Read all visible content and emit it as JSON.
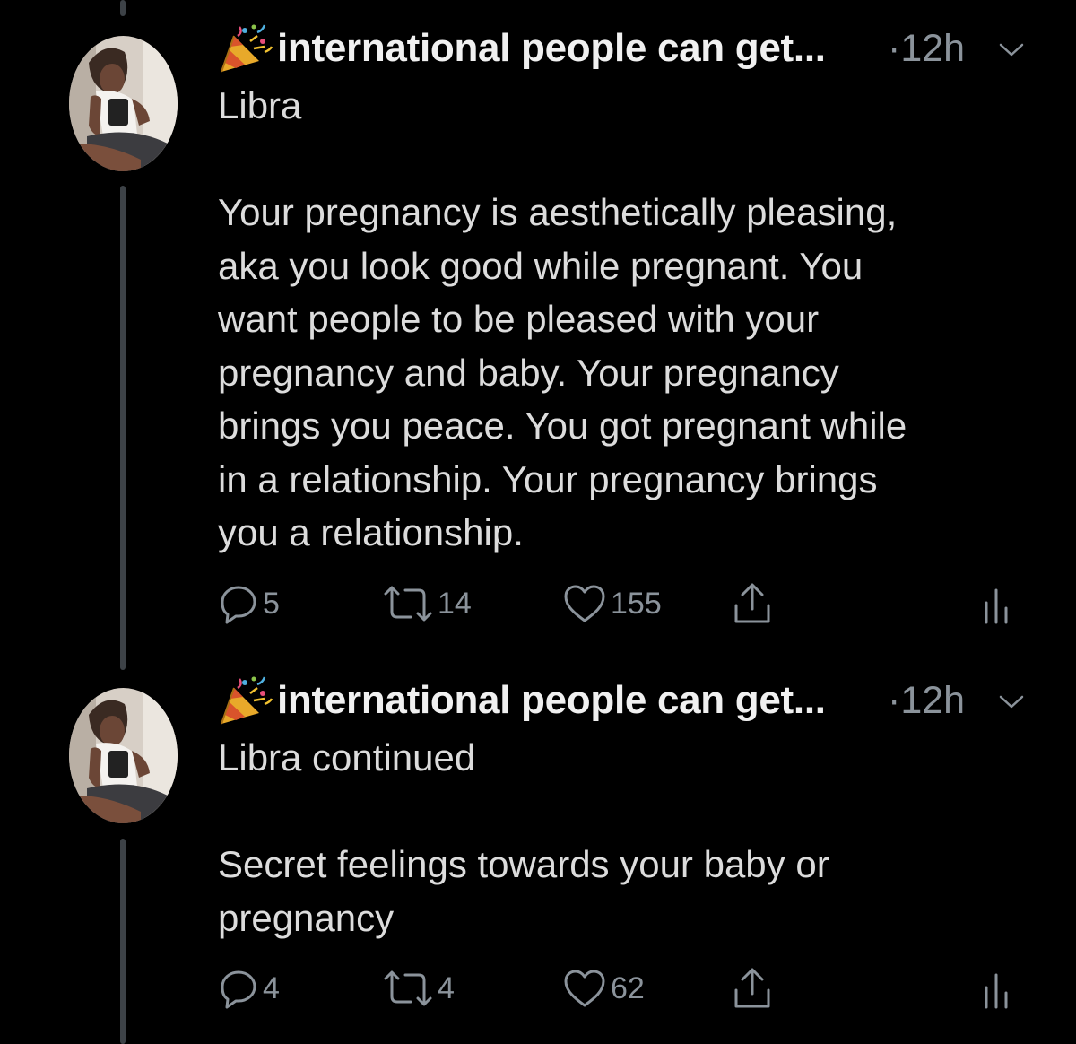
{
  "colors": {
    "background": "#000000",
    "text": "#dcdcdc",
    "muted": "#8b939b",
    "thread_line": "#3d4247"
  },
  "tweets": [
    {
      "author_emoji": "party-popper-icon",
      "author_name": "international people can get...",
      "time": "·12h",
      "body": "Libra\n\nYour pregnancy is aesthetically pleasing,\naka you look good while pregnant. You\nwant people to be pleased with your\npregnancy and baby. Your pregnancy\nbrings you peace. You got pregnant while\nin a relationship. Your pregnancy brings\nyou a relationship.",
      "replies": "5",
      "retweets": "14",
      "likes": "155"
    },
    {
      "author_emoji": "party-popper-icon",
      "author_name": "international people can get...",
      "time": "·12h",
      "body": "Libra continued\n\nSecret feelings towards your baby or\npregnancy",
      "replies": "4",
      "retweets": "4",
      "likes": "62"
    }
  ]
}
